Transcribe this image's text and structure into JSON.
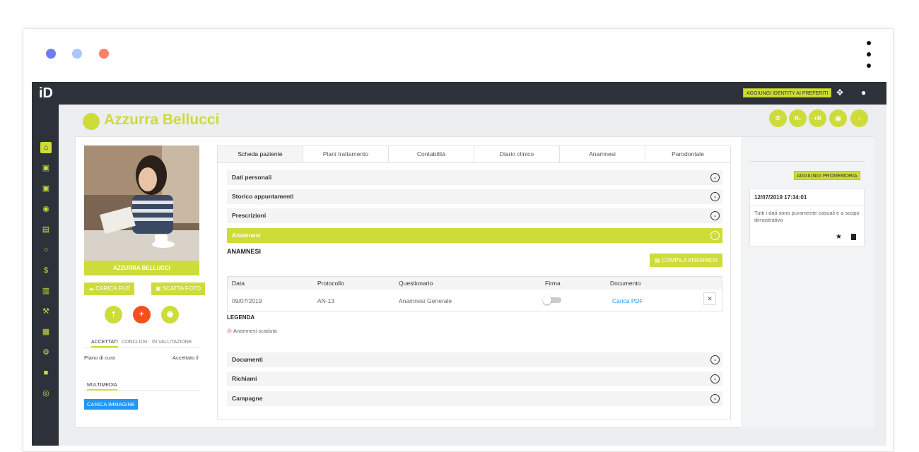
{
  "browser": {
    "dot_colors": [
      "#6f7cf7",
      "#a9c8fb",
      "#f7826a"
    ]
  },
  "topbar": {
    "logo": "iD",
    "fav_button": "AGGIUNGI IDENTITY AI PREFERITI"
  },
  "sidebar": {
    "items": [
      "home-icon",
      "calendar-icon",
      "address-book-icon",
      "user-circle-icon",
      "chart-icon",
      "refresh-icon",
      "dollar-icon",
      "bar-chart-icon",
      "wrench-icon",
      "archive-icon",
      "gear-icon",
      "lock-icon",
      "fingerprint-icon"
    ]
  },
  "header": {
    "patient_name": "Azzurra Bellucci",
    "buttons": [
      "✆",
      "R₁",
      "+R",
      "▤",
      "‹"
    ]
  },
  "profile": {
    "name": "AZZURRA BELLUCCI",
    "upload_label": "CARICA FILE",
    "photo_label": "SCATTA FOTO",
    "subtabs": [
      "ACCETTATI",
      "CONCLUSI",
      "IN VALUTAZIONE"
    ],
    "plan_label": "Piano di cura",
    "accepted_label": "Accettato il",
    "multimedia_tab": "MULTIMEDIA",
    "upload_image": "CARICA IMMAGINE"
  },
  "tabs": [
    "Scheda paziente",
    "Piani trattamento",
    "Contabilità",
    "Diario clinico",
    "Anamnesi",
    "Parodontale"
  ],
  "accordion_top": [
    "Dati personali",
    "Storico appuntamenti",
    "Prescrizioni",
    "Anamnesi"
  ],
  "anamnesi": {
    "title": "ANAMNESI",
    "compile_button": "COMPILA ANAMNESI",
    "columns": [
      "Data",
      "Protocollo",
      "Questionario",
      "Firma",
      "Documento"
    ],
    "row": {
      "data": "09/07/2019",
      "protocollo": "AN-13",
      "questionario": "Anamnesi Generale",
      "documento": "Carica PDF"
    },
    "legend_title": "LEGENDA",
    "legend_item": "Anamnesi scaduta"
  },
  "accordion_bottom": [
    "Documenti",
    "Richiami",
    "Campagne"
  ],
  "reminders": {
    "add_button": "AGGIUNGI PROMEMORIA",
    "timestamp": "12/07/2019 17:34:01",
    "text": "Tutti i dati sono puramente casuali e a scopo dimostrativo"
  }
}
